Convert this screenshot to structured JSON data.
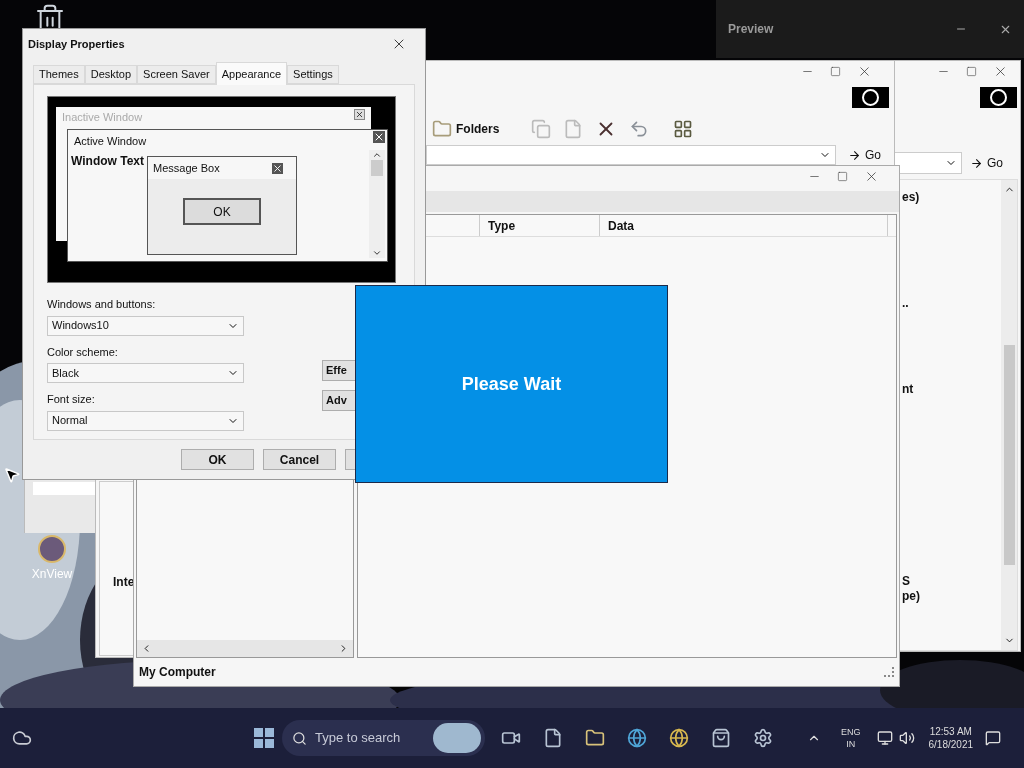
{
  "desktop": {
    "icons": [
      {
        "kind": "recycle-bin"
      },
      {
        "kind": "shortcut",
        "label": "XnView"
      }
    ]
  },
  "preview_window": {
    "title": "Preview"
  },
  "explorer_right": {
    "go_label": "Go",
    "items": [
      "es)",
      "..",
      "nt",
      "S",
      "pe)"
    ]
  },
  "explorer_main": {
    "folders_label": "Folders",
    "go_label": "Go",
    "pane_text": "Inte"
  },
  "registry_window": {
    "columns": [
      "Type",
      "Data"
    ],
    "status": "My Computer"
  },
  "display_properties": {
    "title": "Display Properties",
    "tabs": [
      {
        "label": "Themes",
        "selected": false
      },
      {
        "label": "Desktop",
        "selected": false
      },
      {
        "label": "Screen Saver",
        "selected": false
      },
      {
        "label": "Appearance",
        "selected": true
      },
      {
        "label": "Settings",
        "selected": false
      }
    ],
    "preview": {
      "inactive_title": "Inactive Window",
      "active_title": "Active Window",
      "window_text": "Window Text",
      "message_title": "Message Box",
      "ok_label": "OK"
    },
    "fields": [
      {
        "label": "Windows and buttons:",
        "value": "Windows10"
      },
      {
        "label": "Color scheme:",
        "value": "Black"
      },
      {
        "label": "Font size:",
        "value": "Normal"
      }
    ],
    "side_buttons": [
      "Effe",
      "Adv"
    ],
    "buttons": [
      "OK",
      "Cancel"
    ]
  },
  "wait_box": {
    "text": "Please Wait"
  },
  "taskbar": {
    "search_placeholder": "Type to search",
    "language": "ENG",
    "region": "IN",
    "time": "12:53 AM",
    "date": "6/18/2021"
  }
}
